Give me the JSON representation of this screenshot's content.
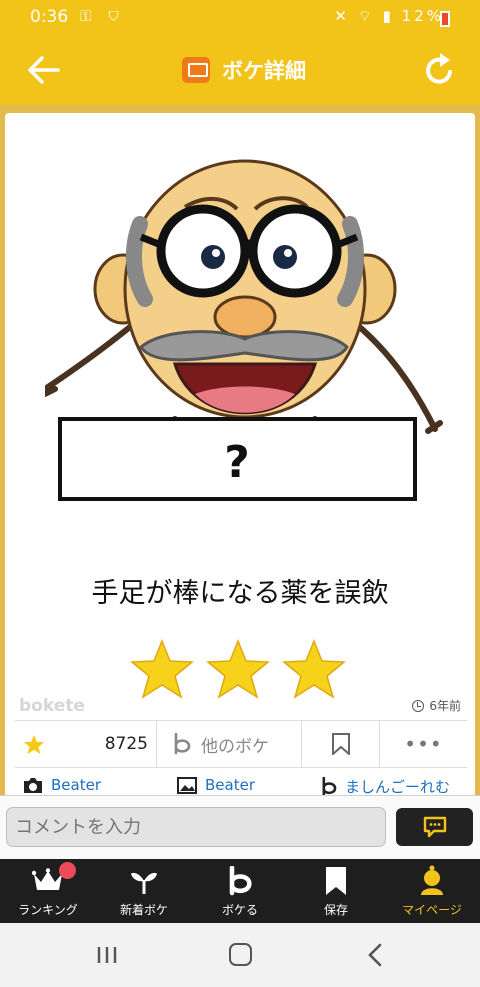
{
  "status_bar": {
    "time": "0:36",
    "battery": "12%"
  },
  "header": {
    "title": "ボケ詳細"
  },
  "post": {
    "image_text": "?",
    "caption": "手足が棒になる薬を誤飲",
    "star_count": 3,
    "watermark": "bokete",
    "age": "6年前"
  },
  "actions": {
    "vote_count": "8725",
    "other_label": "他のボケ",
    "more_label": "•••"
  },
  "credits": {
    "photo_user": "Beater",
    "image_user": "Beater",
    "boke_user": "ましんごーれむ"
  },
  "comment": {
    "placeholder": "コメントを入力"
  },
  "bottom_nav": [
    {
      "label": "ランキング"
    },
    {
      "label": "新着ボケ"
    },
    {
      "label": "ボケる"
    },
    {
      "label": "保存"
    },
    {
      "label": "マイページ"
    }
  ],
  "colors": {
    "brand_yellow": "#f2c318",
    "star_yellow": "#f6d21a",
    "notification_red": "#ef4a5a"
  }
}
